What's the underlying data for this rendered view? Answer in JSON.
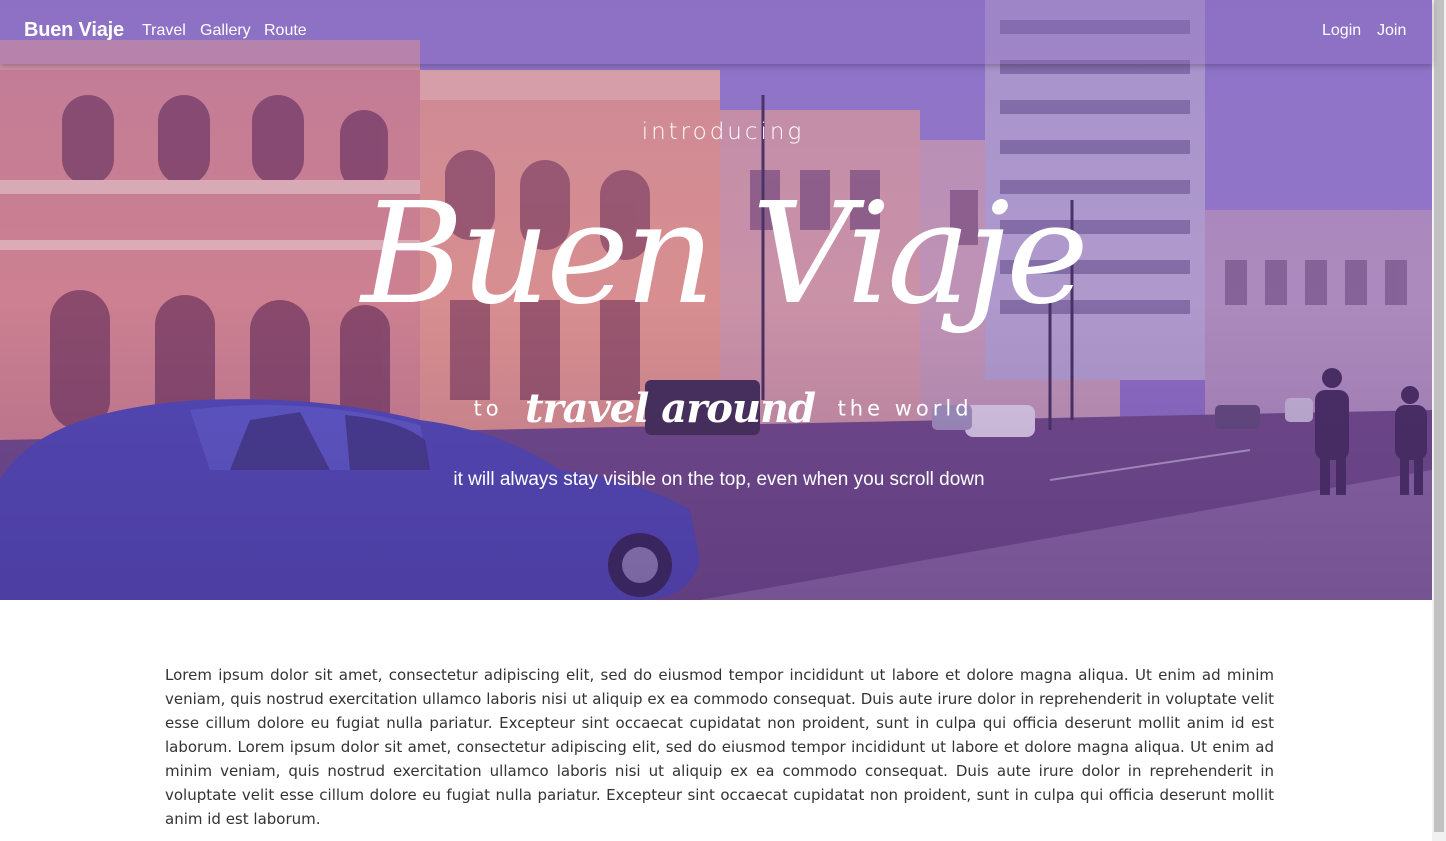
{
  "navbar": {
    "brand": "Buen Viaje",
    "links": [
      "Travel",
      "Gallery",
      "Route"
    ],
    "right_links": [
      "Login",
      "Join"
    ]
  },
  "hero": {
    "pretitle": "introducing",
    "title": "Buen Viaje",
    "sub_left": "to",
    "sub_mid": "travel around",
    "sub_right": "the world",
    "tagline": "it will always stay visible on the top, even when you scroll down"
  },
  "content": {
    "paragraph": "Lorem ipsum dolor sit amet, consectetur adipiscing elit, sed do eiusmod tempor incididunt ut labore et dolore magna aliqua. Ut enim ad minim veniam, quis nostrud exercitation ullamco laboris nisi ut aliquip ex ea commodo consequat. Duis aute irure dolor in reprehenderit in voluptate velit esse cillum dolore eu fugiat nulla pariatur. Excepteur sint occaecat cupidatat non proident, sunt in culpa qui officia deserunt mollit anim id est laborum. Lorem ipsum dolor sit amet, consectetur adipiscing elit, sed do eiusmod tempor incididunt ut labore et dolore magna aliqua. Ut enim ad minim veniam, quis nostrud exercitation ullamco laboris nisi ut aliquip ex ea commodo consequat. Duis aute irure dolor in reprehenderit in voluptate velit esse cillum dolore eu fugiat nulla pariatur. Excepteur sint occaecat cupidatat non proident, sunt in culpa qui officia deserunt mollit anim id est laborum."
  },
  "colors": {
    "overlay": "#8f6ec4",
    "text_on_hero": "#ffffff",
    "body_text": "#333333"
  }
}
